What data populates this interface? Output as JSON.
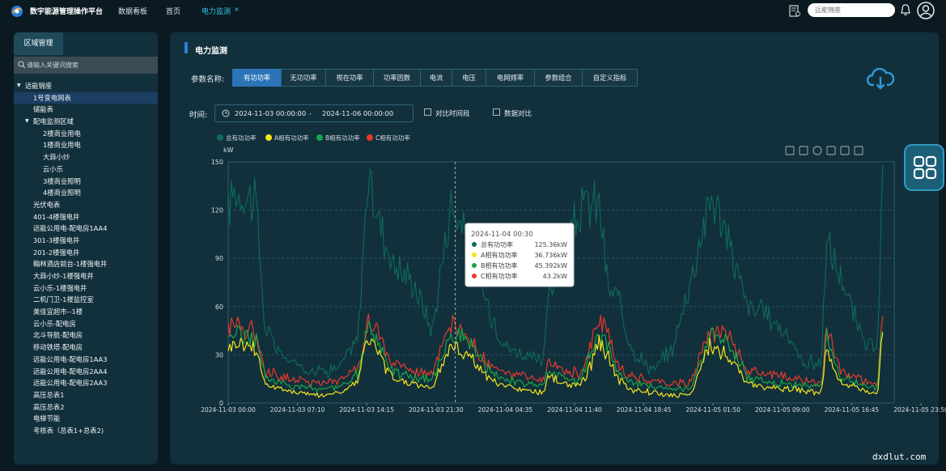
{
  "app": {
    "title": "数宇能源管理操作平台"
  },
  "nav": {
    "tabs": [
      {
        "label": "数据看板"
      },
      {
        "label": "首页"
      },
      {
        "label": "电力监测"
      }
    ],
    "close": "×",
    "site_search_placeholder": "远能锦座"
  },
  "sidebar": {
    "tab": "区域管理",
    "search_placeholder": "请输入关键词搜索",
    "items": [
      {
        "label": "远能锦座",
        "level": 0,
        "expanded": true
      },
      {
        "label": "1号变电网表",
        "level": 1,
        "selected": true
      },
      {
        "label": "储能表",
        "level": 1
      },
      {
        "label": "配电监测区域",
        "level": 1,
        "expanded": true
      },
      {
        "label": "2楼商业用电",
        "level": 2
      },
      {
        "label": "1楼商业用电",
        "level": 2
      },
      {
        "label": "大蒜小炒",
        "level": 2
      },
      {
        "label": "云小乐",
        "level": 2
      },
      {
        "label": "3楼商业照明",
        "level": 2
      },
      {
        "label": "4楼商业照明",
        "level": 2
      },
      {
        "label": "光伏电表",
        "level": 1
      },
      {
        "label": "401-4楼强电井",
        "level": 1
      },
      {
        "label": "远能公用电-配电房1AA4",
        "level": 1
      },
      {
        "label": "301-3楼强电井",
        "level": 1
      },
      {
        "label": "201-2楼强电井",
        "level": 1
      },
      {
        "label": "翰林酒店前台-1楼强电井",
        "level": 1
      },
      {
        "label": "大蒜小炒-1楼强电井",
        "level": 1
      },
      {
        "label": "云小乐-1楼强电井",
        "level": 1
      },
      {
        "label": "二机门卫-1楼监控室",
        "level": 1
      },
      {
        "label": "美佳宜超市--1楼",
        "level": 1
      },
      {
        "label": "云小乐-配电房",
        "level": 1
      },
      {
        "label": "北斗导航-配电房",
        "level": 1
      },
      {
        "label": "移动铁塔-配电房",
        "level": 1
      },
      {
        "label": "远能公用电-配电房1AA3",
        "level": 1
      },
      {
        "label": "远能公用电-配电房2AA4",
        "level": 1
      },
      {
        "label": "远能公用电-配电房2AA3",
        "level": 1
      },
      {
        "label": "高压总表1",
        "level": 1
      },
      {
        "label": "高压总表2",
        "level": 1
      },
      {
        "label": "电梯节能",
        "level": 1
      },
      {
        "label": "考核表（总表1+总表2)",
        "level": 1
      }
    ]
  },
  "main": {
    "title": "电力监测",
    "param_label": "参数名称:",
    "param_tabs": [
      "有功功率",
      "无功功率",
      "视在功率",
      "功率因数",
      "电流",
      "电压",
      "电网频率",
      "参数组合",
      "自定义指标"
    ],
    "param_active_index": 0,
    "time_label": "时间:",
    "start_date": "2024-11-03 00:00:00",
    "range_sep": "-",
    "end_date": "2024-11-06 00:00:00",
    "compare_period_label": "对比时间段",
    "compare_data_label": "数据对比"
  },
  "colors": {
    "total": "#0e6b5b",
    "phase_a": "#f5e61b",
    "phase_b": "#1aa54a",
    "phase_c": "#e8382c",
    "accent": "#2b74b8"
  },
  "chart_data": {
    "type": "line",
    "ylabel": "kW",
    "ylim": [
      0,
      150
    ],
    "yticks": [
      0,
      30,
      60,
      90,
      120,
      150
    ],
    "x_tick_labels": [
      "2024-11-03 00:00",
      "2024-11-03 07:10",
      "2024-11-03 14:15",
      "2024-11-03 21:30",
      "2024-11-04 04:35",
      "2024-11-04 11:40",
      "2024-11-04 18:45",
      "2024-11-05 01:50",
      "2024-11-05 09:00",
      "2024-11-05 16:45",
      "2024-11-05 23:50"
    ],
    "legend_position": "top-left",
    "series": [
      {
        "name": "总有功功率",
        "color": "#0e6b5b",
        "keyframes_hours": [
          0,
          0.5,
          2,
          3,
          4,
          6,
          8,
          10,
          12,
          14,
          15,
          16,
          17,
          18,
          20,
          22,
          24,
          26,
          28,
          30,
          32,
          34,
          34.5,
          36,
          38,
          40,
          41,
          42,
          43,
          44,
          46,
          48,
          50,
          52,
          52.5,
          54,
          56,
          58,
          60,
          62,
          64,
          64.5,
          66,
          68,
          70,
          70.6
        ],
        "values": [
          120,
          132,
          130,
          125,
          45,
          28,
          22,
          20,
          22,
          40,
          138,
          120,
          100,
          85,
          75,
          45,
          125,
          100,
          60,
          35,
          30,
          25,
          70,
          90,
          120,
          125,
          70,
          65,
          45,
          30,
          20,
          35,
          80,
          128,
          125,
          100,
          60,
          55,
          45,
          25,
          25,
          100,
          80,
          45,
          30,
          137
        ]
      },
      {
        "name": "A相有功功率",
        "color": "#f5e61b",
        "keyframes_hours": [
          0,
          1,
          2,
          3,
          4,
          6,
          8,
          10,
          12,
          14,
          15,
          16,
          17,
          18,
          20,
          22,
          24,
          26,
          28,
          30,
          32,
          34,
          34.5,
          36,
          38,
          40,
          41,
          42,
          43,
          44,
          46,
          48,
          50,
          52,
          52.5,
          54,
          56,
          58,
          60,
          62,
          64,
          64.5,
          66,
          68,
          70,
          70.6
        ],
        "values": [
          35,
          38,
          36,
          34,
          12,
          8,
          6,
          5,
          6,
          14,
          40,
          35,
          20,
          15,
          12,
          10,
          36,
          30,
          15,
          10,
          8,
          6,
          18,
          12,
          10,
          36,
          30,
          15,
          10,
          8,
          6,
          5,
          6,
          38,
          32,
          30,
          12,
          10,
          9,
          8,
          6,
          35,
          12,
          9,
          5,
          45
        ]
      },
      {
        "name": "B相有功功率",
        "color": "#1aa54a",
        "keyframes_hours": [
          0,
          1,
          2,
          3,
          4,
          6,
          8,
          10,
          12,
          14,
          15,
          16,
          17,
          18,
          20,
          22,
          24,
          26,
          28,
          30,
          32,
          34,
          34.5,
          36,
          38,
          40,
          41,
          42,
          43,
          44,
          46,
          48,
          50,
          52,
          52.5,
          54,
          56,
          58,
          60,
          62,
          64,
          64.5,
          66,
          68,
          70,
          70.6
        ],
        "values": [
          42,
          44,
          42,
          40,
          16,
          12,
          10,
          9,
          10,
          18,
          44,
          42,
          25,
          20,
          16,
          14,
          45,
          38,
          20,
          14,
          12,
          10,
          22,
          16,
          14,
          44,
          36,
          20,
          14,
          12,
          10,
          9,
          10,
          44,
          40,
          38,
          16,
          14,
          12,
          11,
          10,
          42,
          16,
          12,
          8,
          50
        ]
      },
      {
        "name": "C相有功功率",
        "color": "#e8382c",
        "keyframes_hours": [
          0,
          1,
          2,
          3,
          4,
          6,
          8,
          10,
          12,
          14,
          15,
          16,
          17,
          18,
          20,
          22,
          24,
          26,
          28,
          30,
          32,
          34,
          34.5,
          36,
          38,
          40,
          41,
          42,
          43,
          44,
          46,
          48,
          50,
          52,
          52.5,
          54,
          56,
          58,
          60,
          62,
          64,
          64.5,
          66,
          68,
          70,
          70.6
        ],
        "values": [
          48,
          50,
          46,
          44,
          20,
          16,
          14,
          12,
          14,
          22,
          50,
          46,
          30,
          24,
          20,
          18,
          48,
          40,
          24,
          18,
          16,
          14,
          26,
          20,
          18,
          50,
          42,
          24,
          18,
          16,
          14,
          12,
          14,
          48,
          44,
          42,
          20,
          18,
          16,
          14,
          12,
          48,
          20,
          16,
          10,
          52
        ]
      }
    ],
    "tooltip": {
      "title": "2024-11-04 00:30",
      "hour": 24.5,
      "rows": [
        {
          "name": "总有功功率",
          "value": "125.36kW"
        },
        {
          "name": "A相有功功率",
          "value": "36.736kW"
        },
        {
          "name": "B相有功功率",
          "value": "45.392kW"
        },
        {
          "name": "C相有功功率",
          "value": "43.2kW"
        }
      ]
    }
  },
  "watermark": "dxdlut.com"
}
